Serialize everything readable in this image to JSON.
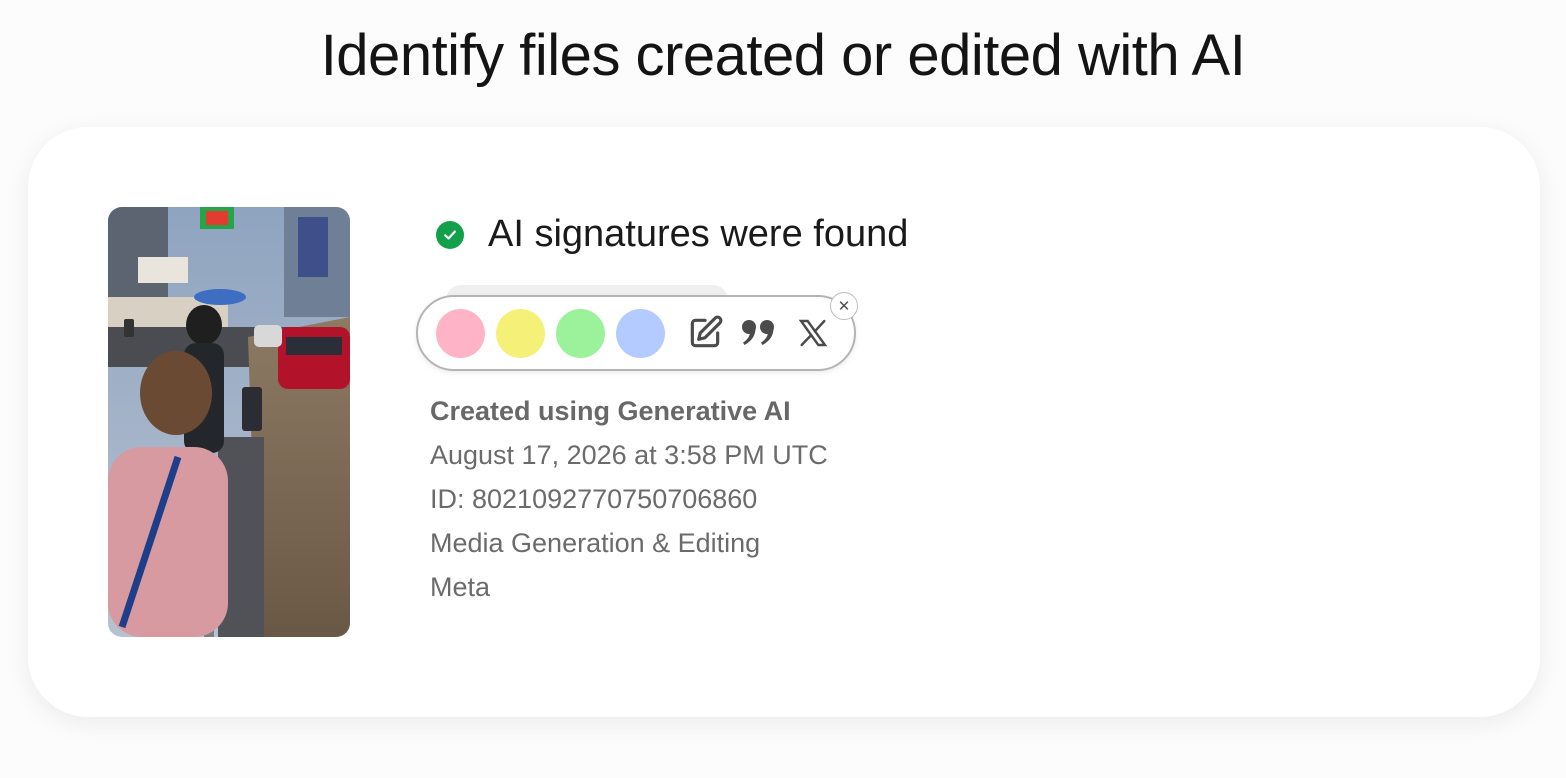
{
  "page": {
    "title": "Identify files created or edited with AI"
  },
  "result": {
    "status_icon": "check-circle-icon",
    "status_color": "#12a04a",
    "status_text": "AI signatures were found",
    "details": {
      "created_label": "Created using Generative AI",
      "timestamp": "August 17, 2026 at 3:58 PM UTC",
      "id": "ID: 8021092770750706860",
      "tool": "Media Generation & Editing",
      "company": "Meta"
    }
  },
  "toolbar": {
    "swatches": [
      {
        "name": "pink",
        "color": "#ffb3c6"
      },
      {
        "name": "yellow",
        "color": "#f5f078"
      },
      {
        "name": "green",
        "color": "#9bf29b"
      },
      {
        "name": "blue",
        "color": "#b4cbff"
      }
    ],
    "tools": [
      "edit-icon",
      "quote-icon",
      "x-logo-icon"
    ],
    "close_glyph": "✕"
  }
}
